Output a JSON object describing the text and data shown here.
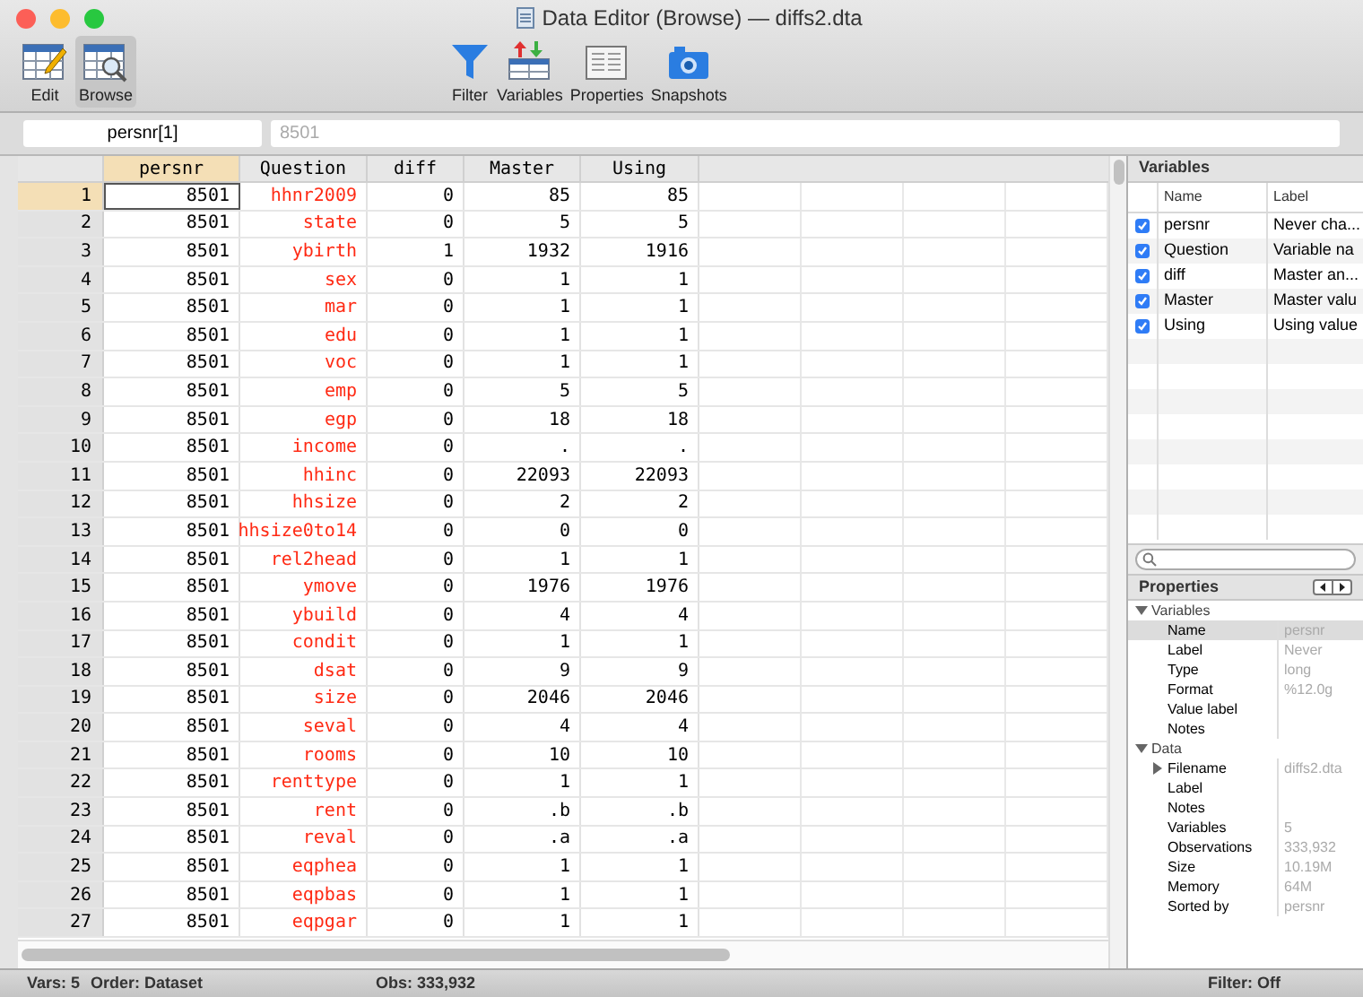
{
  "window": {
    "title": "Data Editor (Browse) — diffs2.dta"
  },
  "toolbar": {
    "modes": [
      {
        "label": "Edit",
        "kind": "edit",
        "selected": false
      },
      {
        "label": "Browse",
        "kind": "browse",
        "selected": true
      }
    ],
    "tools": [
      {
        "label": "Filter",
        "kind": "filter"
      },
      {
        "label": "Variables",
        "kind": "variables"
      },
      {
        "label": "Properties",
        "kind": "properties"
      },
      {
        "label": "Snapshots",
        "kind": "snapshots"
      }
    ]
  },
  "cell_bar": {
    "name": "persnr[1]",
    "value": "8501"
  },
  "grid": {
    "columns": [
      {
        "label": "persnr",
        "selected": true,
        "color": "#000000"
      },
      {
        "label": "Question",
        "selected": false,
        "color": "#ff2a14"
      },
      {
        "label": "diff",
        "selected": false,
        "color": "#000000"
      },
      {
        "label": "Master",
        "selected": false,
        "color": "#000000"
      },
      {
        "label": "Using",
        "selected": false,
        "color": "#000000"
      }
    ],
    "rows": [
      {
        "number": "1",
        "selected": true,
        "cells": [
          "8501",
          "hhnr2009",
          "0",
          "85",
          "85"
        ]
      },
      {
        "number": "2",
        "selected": false,
        "cells": [
          "8501",
          "state",
          "0",
          "5",
          "5"
        ]
      },
      {
        "number": "3",
        "selected": false,
        "cells": [
          "8501",
          "ybirth",
          "1",
          "1932",
          "1916"
        ]
      },
      {
        "number": "4",
        "selected": false,
        "cells": [
          "8501",
          "sex",
          "0",
          "1",
          "1"
        ]
      },
      {
        "number": "5",
        "selected": false,
        "cells": [
          "8501",
          "mar",
          "0",
          "1",
          "1"
        ]
      },
      {
        "number": "6",
        "selected": false,
        "cells": [
          "8501",
          "edu",
          "0",
          "1",
          "1"
        ]
      },
      {
        "number": "7",
        "selected": false,
        "cells": [
          "8501",
          "voc",
          "0",
          "1",
          "1"
        ]
      },
      {
        "number": "8",
        "selected": false,
        "cells": [
          "8501",
          "emp",
          "0",
          "5",
          "5"
        ]
      },
      {
        "number": "9",
        "selected": false,
        "cells": [
          "8501",
          "egp",
          "0",
          "18",
          "18"
        ]
      },
      {
        "number": "10",
        "selected": false,
        "cells": [
          "8501",
          "income",
          "0",
          ".",
          "."
        ]
      },
      {
        "number": "11",
        "selected": false,
        "cells": [
          "8501",
          "hhinc",
          "0",
          "22093",
          "22093"
        ]
      },
      {
        "number": "12",
        "selected": false,
        "cells": [
          "8501",
          "hhsize",
          "0",
          "2",
          "2"
        ]
      },
      {
        "number": "13",
        "selected": false,
        "cells": [
          "8501",
          "hhsize0to14",
          "0",
          "0",
          "0"
        ]
      },
      {
        "number": "14",
        "selected": false,
        "cells": [
          "8501",
          "rel2head",
          "0",
          "1",
          "1"
        ]
      },
      {
        "number": "15",
        "selected": false,
        "cells": [
          "8501",
          "ymove",
          "0",
          "1976",
          "1976"
        ]
      },
      {
        "number": "16",
        "selected": false,
        "cells": [
          "8501",
          "ybuild",
          "0",
          "4",
          "4"
        ]
      },
      {
        "number": "17",
        "selected": false,
        "cells": [
          "8501",
          "condit",
          "0",
          "1",
          "1"
        ]
      },
      {
        "number": "18",
        "selected": false,
        "cells": [
          "8501",
          "dsat",
          "0",
          "9",
          "9"
        ]
      },
      {
        "number": "19",
        "selected": false,
        "cells": [
          "8501",
          "size",
          "0",
          "2046",
          "2046"
        ]
      },
      {
        "number": "20",
        "selected": false,
        "cells": [
          "8501",
          "seval",
          "0",
          "4",
          "4"
        ]
      },
      {
        "number": "21",
        "selected": false,
        "cells": [
          "8501",
          "rooms",
          "0",
          "10",
          "10"
        ]
      },
      {
        "number": "22",
        "selected": false,
        "cells": [
          "8501",
          "renttype",
          "0",
          "1",
          "1"
        ]
      },
      {
        "number": "23",
        "selected": false,
        "cells": [
          "8501",
          "rent",
          "0",
          ".b",
          ".b"
        ]
      },
      {
        "number": "24",
        "selected": false,
        "cells": [
          "8501",
          "reval",
          "0",
          ".a",
          ".a"
        ]
      },
      {
        "number": "25",
        "selected": false,
        "cells": [
          "8501",
          "eqphea",
          "0",
          "1",
          "1"
        ]
      },
      {
        "number": "26",
        "selected": false,
        "cells": [
          "8501",
          "eqpbas",
          "0",
          "1",
          "1"
        ]
      },
      {
        "number": "27",
        "selected": false,
        "cells": [
          "8501",
          "eqpgar",
          "0",
          "1",
          "1"
        ]
      }
    ]
  },
  "variables_panel": {
    "title": "Variables",
    "columns": [
      "Name",
      "Label"
    ],
    "items": [
      {
        "checked": true,
        "name": "persnr",
        "label": "Never cha..."
      },
      {
        "checked": true,
        "name": "Question",
        "label": "Variable na"
      },
      {
        "checked": true,
        "name": "diff",
        "label": "Master an..."
      },
      {
        "checked": true,
        "name": "Master",
        "label": "Master valu"
      },
      {
        "checked": true,
        "name": "Using",
        "label": "Using value"
      }
    ]
  },
  "properties_panel": {
    "title": "Properties",
    "groups": [
      {
        "name": "Variables",
        "expanded": true,
        "items": [
          {
            "name": "Name",
            "value": "persnr",
            "selected": true
          },
          {
            "name": "Label",
            "value": "Never",
            "selected": false
          },
          {
            "name": "Type",
            "value": "long",
            "selected": false
          },
          {
            "name": "Format",
            "value": "%12.0g",
            "selected": false
          },
          {
            "name": "Value label",
            "selected": false
          },
          {
            "name": "Notes",
            "selected": false
          }
        ]
      },
      {
        "name": "Data",
        "expanded": true,
        "items": [
          {
            "name": "Filename",
            "value": "diffs2.dta",
            "selected": false,
            "expanded": false
          },
          {
            "name": "Label",
            "selected": false
          },
          {
            "name": "Notes",
            "selected": false
          },
          {
            "name": "Variables",
            "value": "5",
            "selected": false
          },
          {
            "name": "Observations",
            "value": "333,932",
            "selected": false
          },
          {
            "name": "Size",
            "value": "10.19M",
            "selected": false
          },
          {
            "name": "Memory",
            "value": "64M",
            "selected": false
          },
          {
            "name": "Sorted by",
            "value": "persnr",
            "selected": false
          }
        ]
      }
    ]
  },
  "status_bar": {
    "vars": "Vars: 5",
    "order": "Order: Dataset",
    "obs": "Obs: 333,932",
    "filter": "Filter: Off"
  }
}
